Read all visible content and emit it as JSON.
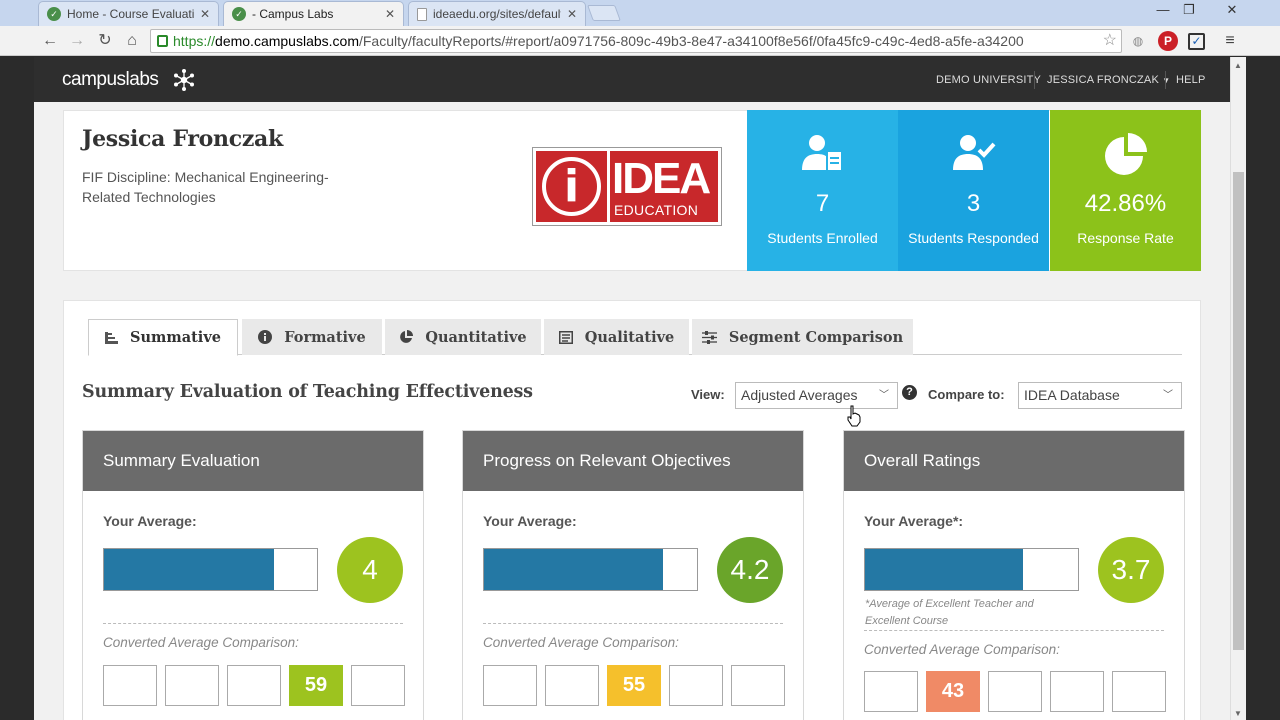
{
  "browser": {
    "tabs": [
      {
        "title": "Home - Course Evaluation",
        "state": "inactive"
      },
      {
        "title": "- Campus Labs",
        "state": "active"
      },
      {
        "title": "ideaedu.org/sites/default/",
        "state": "inactive"
      }
    ],
    "url": {
      "scheme": "https://",
      "host": "demo.campuslabs.com",
      "path": "/Faculty/facultyReports/#report/a0971756-809c-49b3-8e47-a34100f8e56f/0fa45fc9-c49c-4ed8-a5fe-a34200"
    },
    "window_controls": {
      "minimize": "—",
      "restore": "❐",
      "close": "✕"
    }
  },
  "app": {
    "brand": "campuslabs",
    "nav": {
      "university": "DEMO UNIVERSITY",
      "user": "JESSICA FRONCZAK",
      "help": "HELP"
    }
  },
  "profile": {
    "name": "Jessica Fronczak",
    "discipline_line1": "FIF Discipline: Mechanical Engineering-",
    "discipline_line2": "Related Technologies",
    "logo": {
      "letter": "i",
      "word": "IDEA",
      "subword": "EDUCATION"
    }
  },
  "stats": [
    {
      "value": "7",
      "label": "Students Enrolled",
      "color": "#27b2e6",
      "icon": "student-enrolled-icon"
    },
    {
      "value": "3",
      "label": "Students Responded",
      "color": "#1aa3df",
      "icon": "student-responded-icon"
    },
    {
      "value": "42.86%",
      "label": "Response Rate",
      "color": "#8cc21a",
      "icon": "pie-chart-icon"
    }
  ],
  "report_tabs": [
    {
      "label": "Summative",
      "icon": "bar-chart-icon",
      "active": true
    },
    {
      "label": "Formative",
      "icon": "info-icon",
      "active": false
    },
    {
      "label": "Quantitative",
      "icon": "pie-chart-icon",
      "active": false
    },
    {
      "label": "Qualitative",
      "icon": "document-icon",
      "active": false
    },
    {
      "label": "Segment Comparison",
      "icon": "sliders-icon",
      "active": false
    }
  ],
  "section": {
    "title": "Summary Evaluation of Teaching Effectiveness",
    "view_label": "View:",
    "view_value": "Adjusted Averages",
    "compare_label": "Compare to:",
    "compare_value": "IDEA Database"
  },
  "panels": [
    {
      "title": "Summary Evaluation",
      "avg_label": "Your Average:",
      "score": "4",
      "bar_fraction": 0.8,
      "score_color": "#9dc31f",
      "note": "",
      "conv_label": "Converted Average Comparison:",
      "boxes": [
        "",
        "",
        "",
        "59",
        ""
      ],
      "highlight_index": 3,
      "highlight_color": "#9dc31f"
    },
    {
      "title": "Progress on Relevant Objectives",
      "avg_label": "Your Average:",
      "score": "4.2",
      "bar_fraction": 0.84,
      "score_color": "#6aa52a",
      "note": "",
      "conv_label": "Converted Average Comparison:",
      "boxes": [
        "",
        "",
        "55",
        "",
        ""
      ],
      "highlight_index": 2,
      "highlight_color": "#f5c02c"
    },
    {
      "title": "Overall Ratings",
      "avg_label": "Your Average*:",
      "score": "3.7",
      "bar_fraction": 0.74,
      "score_color": "#9dc31f",
      "note_line1": "*Average of Excellent Teacher and",
      "note_line2": "Excellent Course",
      "conv_label": "Converted Average Comparison:",
      "boxes": [
        "",
        "43",
        "",
        "",
        ""
      ],
      "highlight_index": 1,
      "highlight_color": "#f08a66"
    }
  ]
}
